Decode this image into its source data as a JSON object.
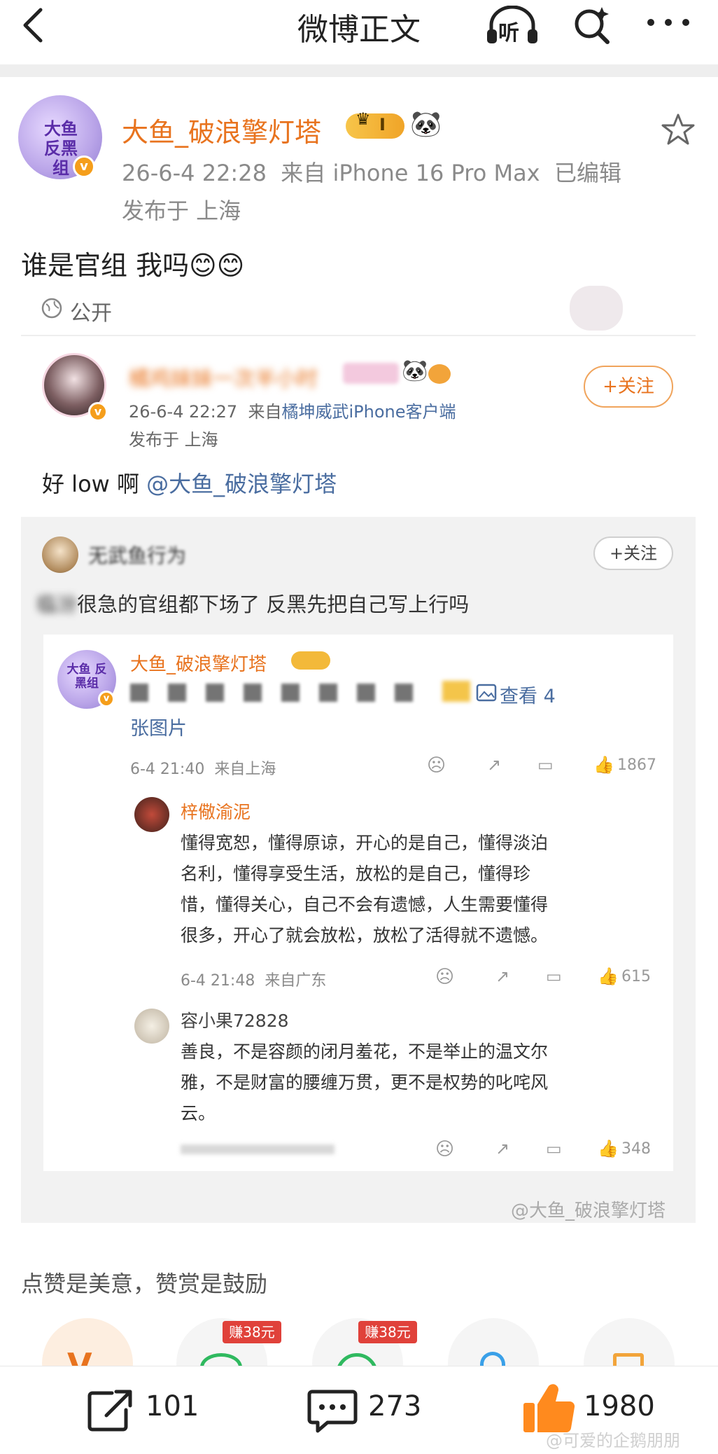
{
  "nav": {
    "title": "微博正文",
    "listen_label": "听"
  },
  "post": {
    "author": "大鱼_破浪擎灯塔",
    "avatar_text": "大鱼 反黑组",
    "level_badge": "I",
    "meta_line": "26-6-4 22:28  来自 iPhone 16 Pro Max  已编辑",
    "location": "发布于 上海",
    "content": "谁是官组 我吗😊😊",
    "visibility": "公开"
  },
  "quoted": {
    "author": "橘鸡妹妹一次半小时",
    "date": "26-6-4 22:27",
    "source_prefix": "来自",
    "source": "橘坤威武iPhone客户端",
    "location": "发布于 上海",
    "follow_label": "+关注",
    "content_prefix": "好 low 啊 ",
    "mention": "@大鱼_破浪擎灯塔"
  },
  "repost": {
    "author": "无武鱼行为",
    "follow_label": "+关注",
    "content_blurred": "临汾",
    "content": "很急的官组都下场了 反黑先把自己写上行吗",
    "watermark": "@大鱼_破浪擎灯塔"
  },
  "inner": {
    "author": "大鱼_破浪擎灯塔",
    "avatar_text": "大鱼 反黑组",
    "view_images": "查看 4",
    "view_images_2": "张图片",
    "meta": "6-4 21:40  来自上海",
    "likes": "1867",
    "comments": [
      {
        "name": "梓儆渝泥",
        "text_lines": [
          "懂得宽恕，懂得原谅，开心的是自己，懂得淡泊",
          "名利，懂得享受生活，放松的是自己，懂得珍",
          "惜，懂得关心，自己不会有遗憾，人生需要懂得",
          "很多，开心了就会放松，放松了活得就不遗憾。"
        ],
        "meta": "6-4 21:48  来自广东",
        "likes": "615"
      },
      {
        "name": "容小果72828",
        "text_lines": [
          "善良，不是容颜的闭月羞花，不是举止的温文尔",
          "雅，不是财富的腰缠万贯，更不是权势的叱咤风",
          "云。"
        ],
        "meta": "",
        "likes": "348"
      }
    ]
  },
  "reward": {
    "hint": "点赞是美意，赞赏是鼓励",
    "tags": [
      "赚38元",
      "赚38元"
    ]
  },
  "bottom": {
    "reposts": "101",
    "comments": "273",
    "likes": "1980",
    "watermark": "@可爱的企鹅朋朋"
  }
}
